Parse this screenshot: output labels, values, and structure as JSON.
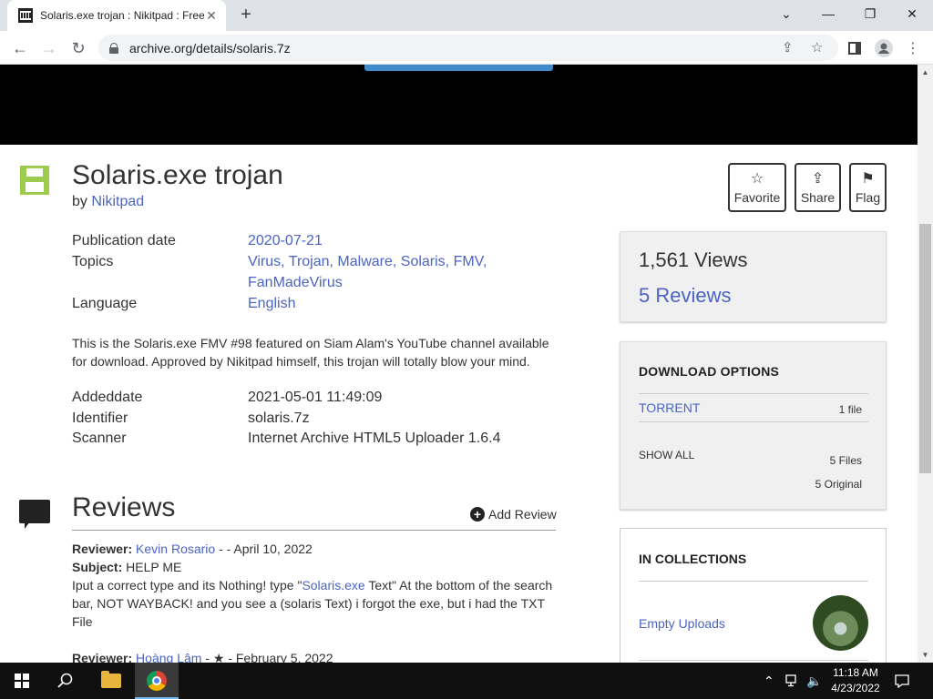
{
  "browser": {
    "tab_title": "Solaris.exe trojan : Nikitpad : Free",
    "url": "archive.org/details/solaris.7z"
  },
  "item": {
    "title": "Solaris.exe trojan",
    "by_label": "by",
    "author": "Nikitpad"
  },
  "actions": {
    "favorite": "Favorite",
    "share": "Share",
    "flag": "Flag"
  },
  "metadata": {
    "pubdate_label": "Publication date",
    "pubdate": "2020-07-21",
    "topics_label": "Topics",
    "topics_line1": "Virus, Trojan, Malware, Solaris, FMV,",
    "topics_line2": "FanMadeVirus",
    "language_label": "Language",
    "language": "English",
    "description": "This is the Solaris.exe FMV #98 featured on Siam Alam's YouTube channel available for download. Approved by Nikitpad himself, this trojan will totally blow your mind.",
    "addeddate_label": "Addeddate",
    "addeddate": "2021-05-01 11:49:09",
    "identifier_label": "Identifier",
    "identifier": "solaris.7z",
    "scanner_label": "Scanner",
    "scanner": "Internet Archive HTML5 Uploader 1.6.4"
  },
  "stats": {
    "views": "1,561 Views",
    "reviews": "5 Reviews"
  },
  "downloads": {
    "heading": "DOWNLOAD OPTIONS",
    "torrent": "TORRENT",
    "torrent_count": "1 file",
    "show_all": "SHOW ALL",
    "files": "5 Files",
    "original": "5 Original"
  },
  "collections": {
    "heading": "IN COLLECTIONS",
    "name": "Empty Uploads"
  },
  "reviews": {
    "heading": "Reviews",
    "add_review": "Add Review",
    "reviewer_label": "Reviewer:",
    "subject_label": "Subject:",
    "r1_name": "Kevin Rosario",
    "r1_meta": " - - April 10, 2022",
    "r1_subject": "HELP ME",
    "r1_body_a": "Iput a correct type and its Nothing! type \"",
    "r1_body_link": "Solaris.exe",
    "r1_body_b": " Text\" At the bottom of the search bar, NOT WAYBACK! and you see a (solaris Text) i forgot the exe, but i had the TXT File",
    "r2_name": "Hoàng Lâm",
    "r2_meta": " - ★ - February 5, 2022"
  },
  "taskbar": {
    "time": "11:18 AM",
    "date": "4/23/2022"
  }
}
